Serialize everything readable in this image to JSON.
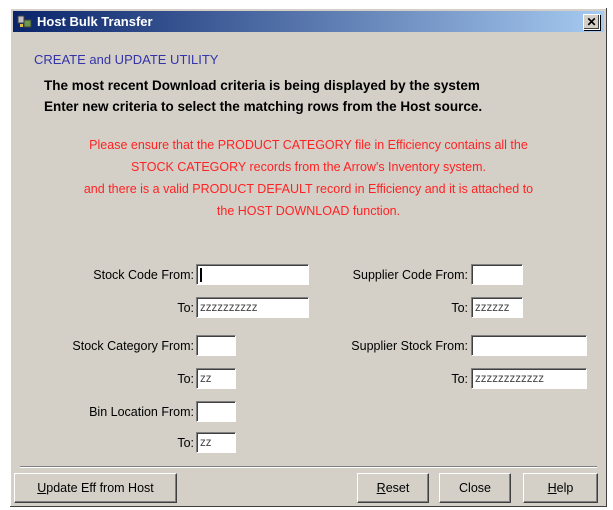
{
  "window": {
    "title": "Host Bulk Transfer",
    "close_glyph": "✕"
  },
  "header": "CREATE and UPDATE UTILITY",
  "info_lines": [
    "The most recent Download criteria is being displayed by the system",
    "Enter new criteria to select the matching rows from the Host source."
  ],
  "warning_lines": [
    "Please ensure that the PRODUCT CATEGORY file in Efficiency contains all the",
    "STOCK CATEGORY records from the Arrow's Inventory system.",
    "and there is a valid PRODUCT DEFAULT record in Efficiency and it is attached to",
    "the HOST DOWNLOAD function."
  ],
  "fields": {
    "stock_code_from_label": "Stock Code From:",
    "stock_code_from_value": "",
    "stock_code_to_label": "To:",
    "stock_code_to_value": "zzzzzzzzzz",
    "stock_category_from_label": "Stock Category From:",
    "stock_category_from_value": "",
    "stock_category_to_label": "To:",
    "stock_category_to_value": "zz",
    "bin_location_from_label": "Bin Location From:",
    "bin_location_from_value": "",
    "bin_location_to_label": "To:",
    "bin_location_to_value": "zz",
    "supplier_code_from_label": "Supplier Code From:",
    "supplier_code_from_value": "",
    "supplier_code_to_label": "To:",
    "supplier_code_to_value": "zzzzzz",
    "supplier_stock_from_label": "Supplier Stock From:",
    "supplier_stock_from_value": "",
    "supplier_stock_to_label": "To:",
    "supplier_stock_to_value": "zzzzzzzzzzzz"
  },
  "buttons": {
    "update_first": "U",
    "update_rest": "pdate Eff from Host",
    "reset_first": "R",
    "reset_rest": "eset",
    "close": "Close",
    "help_first": "H",
    "help_rest": "elp"
  },
  "colors": {
    "titlebar_start": "#0a246a",
    "titlebar_end": "#a6caf0",
    "header_text": "#3333aa",
    "warning_text": "#ff2222",
    "dialog_face": "#d4d0c8"
  }
}
